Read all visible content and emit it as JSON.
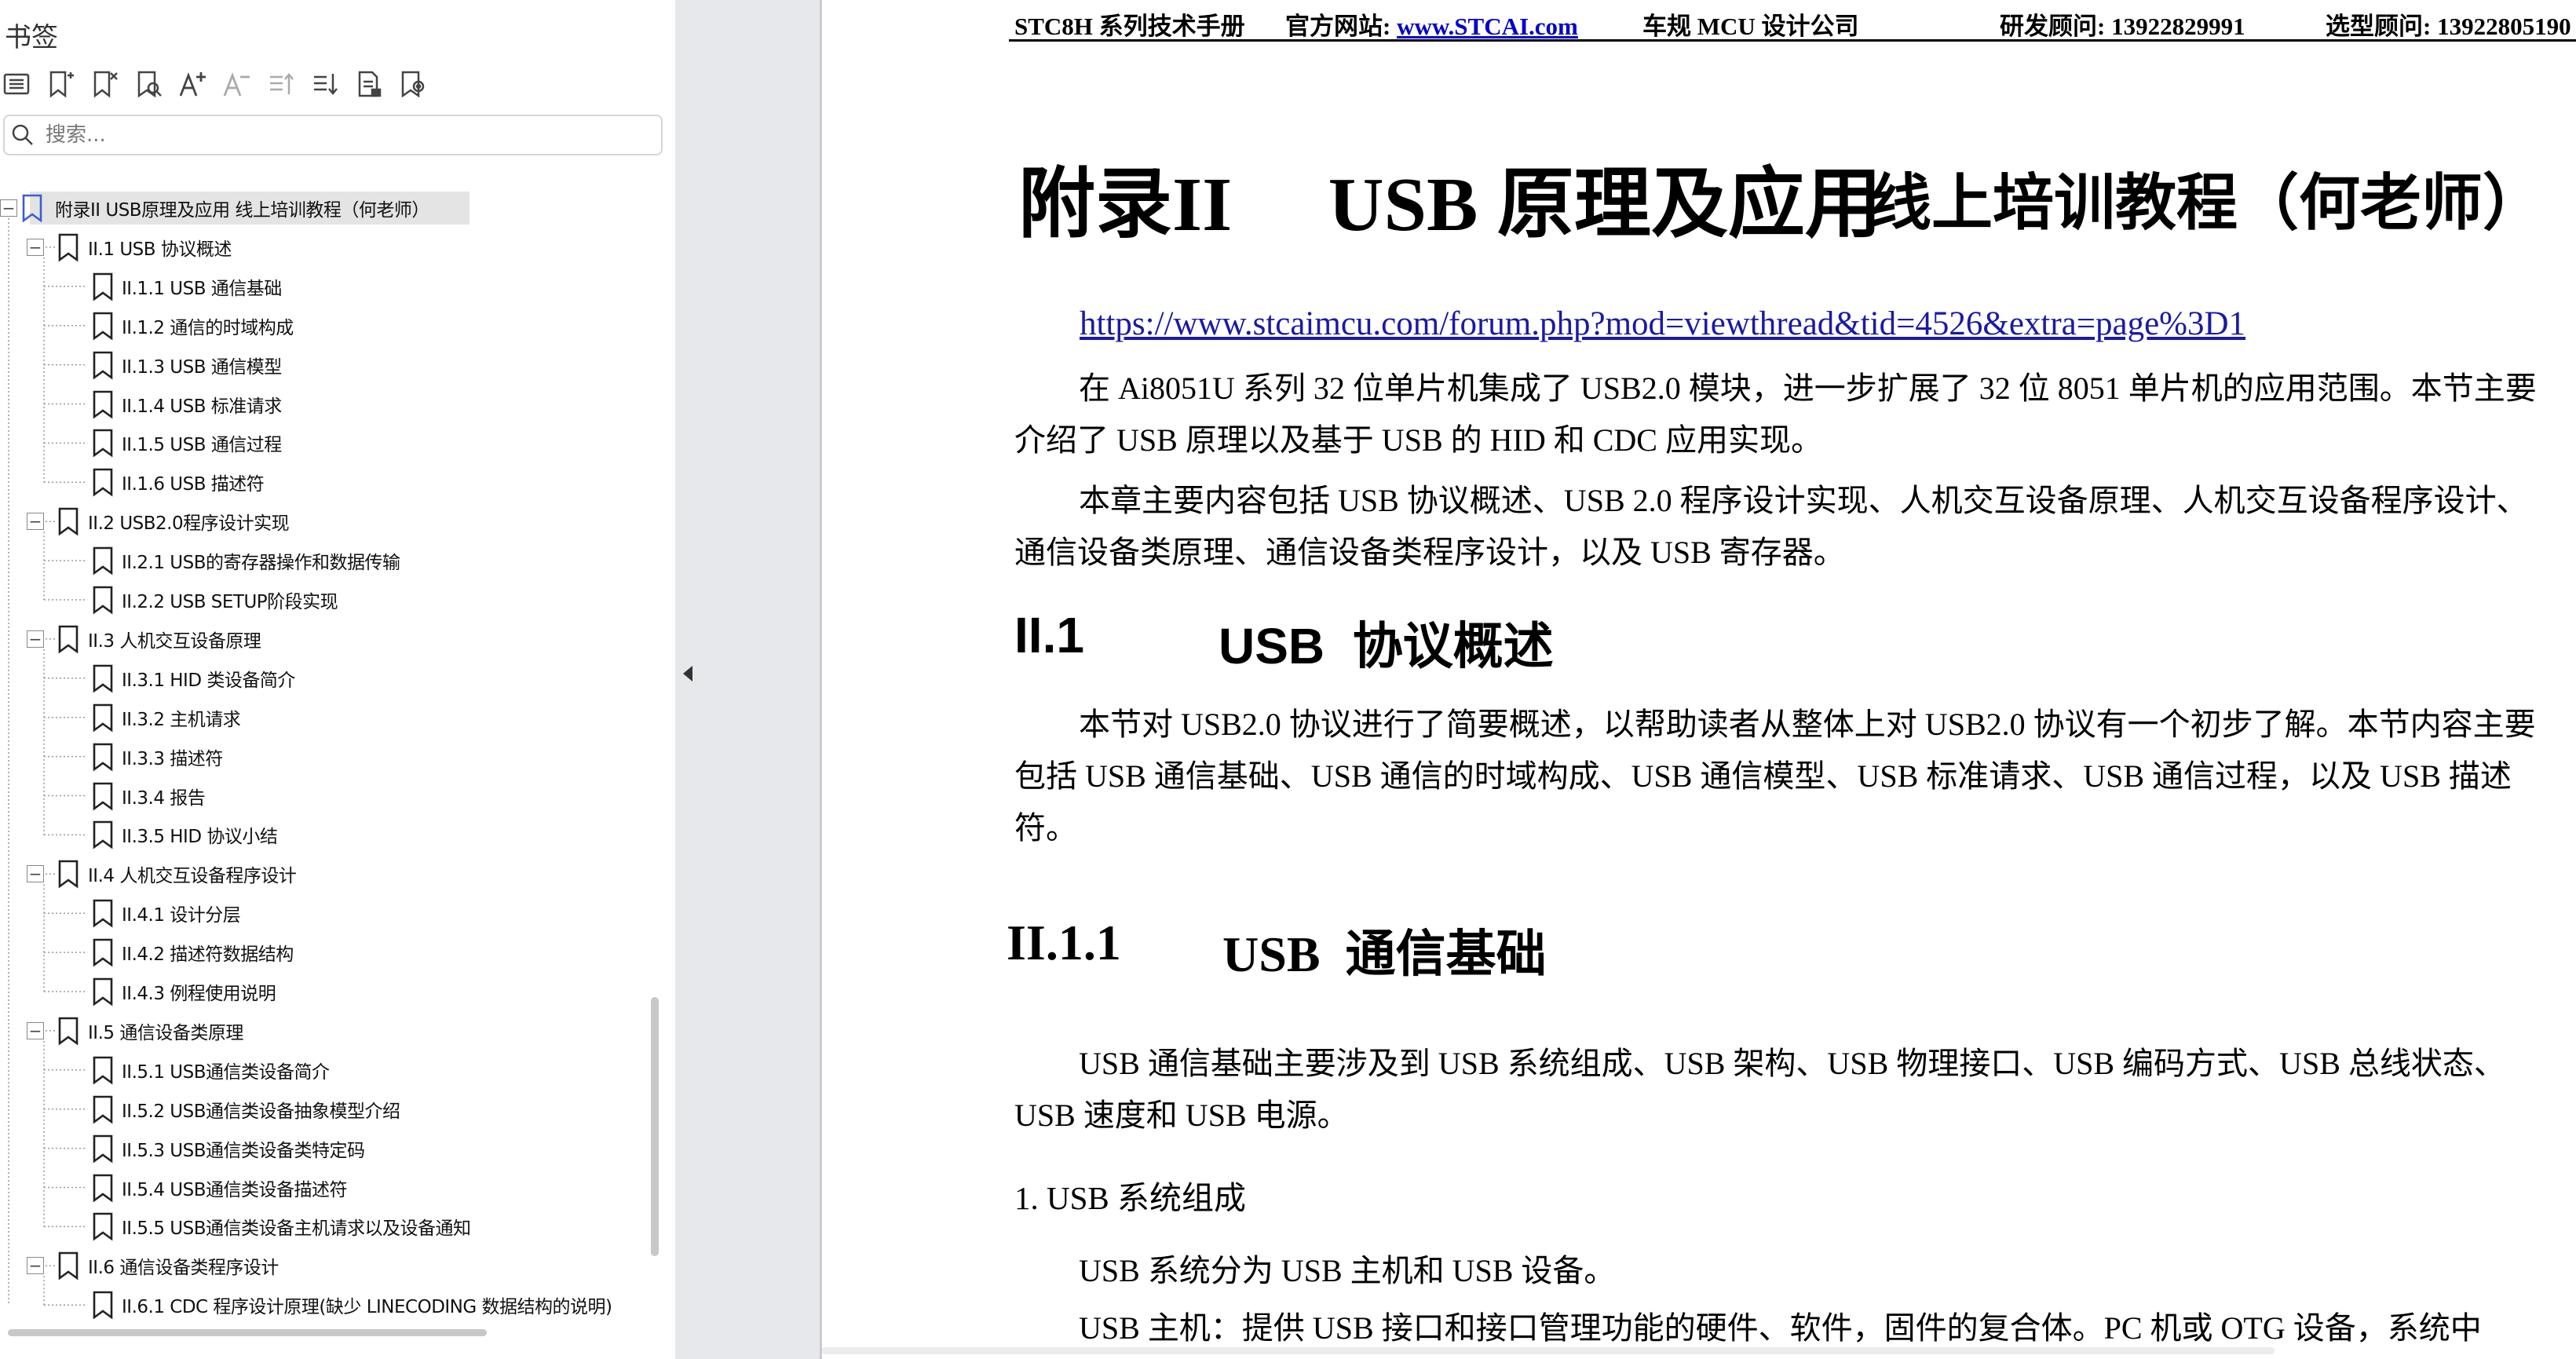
{
  "sidebar": {
    "title": "书签",
    "toolbar_icons": [
      "expand-list-icon",
      "add-bookmark-icon",
      "delete-bookmark-icon",
      "find-bookmark-icon",
      "font-increase-icon",
      "font-decrease-icon",
      "promote-bookmark-icon",
      "demote-bookmark-icon",
      "bookmark-properties-icon",
      "bookmark-settings-icon"
    ],
    "search_placeholder": "搜索...",
    "tree": [
      {
        "level": 0,
        "label": "附录II  USB原理及应用 线上培训教程（何老师）",
        "expanded": true,
        "selected": true
      },
      {
        "level": 1,
        "label": "II.1 USB 协议概述",
        "expanded": true
      },
      {
        "level": 2,
        "label": "II.1.1 USB 通信基础"
      },
      {
        "level": 2,
        "label": "II.1.2 通信的时域构成"
      },
      {
        "level": 2,
        "label": "II.1.3 USB 通信模型"
      },
      {
        "level": 2,
        "label": "II.1.4 USB 标准请求"
      },
      {
        "level": 2,
        "label": "II.1.5 USB 通信过程"
      },
      {
        "level": 2,
        "label": "II.1.6 USB 描述符"
      },
      {
        "level": 1,
        "label": "II.2  USB2.0程序设计实现",
        "expanded": true
      },
      {
        "level": 2,
        "label": "II.2.1 USB的寄存器操作和数据传输"
      },
      {
        "level": 2,
        "label": "II.2.2 USB SETUP阶段实现"
      },
      {
        "level": 1,
        "label": "II.3  人机交互设备原理",
        "expanded": true
      },
      {
        "level": 2,
        "label": "II.3.1 HID 类设备简介"
      },
      {
        "level": 2,
        "label": "II.3.2 主机请求"
      },
      {
        "level": 2,
        "label": "II.3.3 描述符"
      },
      {
        "level": 2,
        "label": "II.3.4 报告"
      },
      {
        "level": 2,
        "label": "II.3.5 HID 协议小结"
      },
      {
        "level": 1,
        "label": "II.4  人机交互设备程序设计",
        "expanded": true
      },
      {
        "level": 2,
        "label": "II.4.1 设计分层"
      },
      {
        "level": 2,
        "label": "II.4.2 描述符数据结构"
      },
      {
        "level": 2,
        "label": "II.4.3 例程使用说明"
      },
      {
        "level": 1,
        "label": "II.5  通信设备类原理",
        "expanded": true
      },
      {
        "level": 2,
        "label": "II.5.1 USB通信类设备简介"
      },
      {
        "level": 2,
        "label": "II.5.2 USB通信类设备抽象模型介绍"
      },
      {
        "level": 2,
        "label": "II.5.3 USB通信类设备类特定码"
      },
      {
        "level": 2,
        "label": "II.5.4 USB通信类设备描述符"
      },
      {
        "level": 2,
        "label": "II.5.5 USB通信类设备主机请求以及设备通知"
      },
      {
        "level": 1,
        "label": "II.6  通信设备类程序设计",
        "expanded": true
      },
      {
        "level": 2,
        "label": "II.6.1 CDC 程序设计原理(缺少 LINECODING 数据结构的说明)"
      }
    ]
  },
  "document": {
    "header": {
      "manual": "STC8H 系列技术手册",
      "site_label": "官方网站: ",
      "site_link": "www.STCAI.com",
      "company": "车规 MCU 设计公司",
      "rd_contact": "研发顾问: 13922829991",
      "sel_contact": "选型顾问: 13922805190"
    },
    "appendix_title": "附录II     USB 原理及应用",
    "appendix_subtitle": "线上培训教程（何老师）",
    "forum_link": "https://www.stcaimcu.com/forum.php?mod=viewthread&tid=4526&extra=page%3D1",
    "intro_p1": "在 Ai8051U 系列 32 位单片机集成了 USB2.0 模块，进一步扩展了 32 位 8051 单片机的应用范围。本节主要介绍了 USB 原理以及基于 USB 的 HID 和 CDC 应用实现。",
    "intro_p2": "本章主要内容包括 USB 协议概述、USB 2.0 程序设计实现、人机交互设备原理、人机交互设备程序设计、通信设备类原理、通信设备类程序设计，以及 USB 寄存器。",
    "sec1_num": "II.1",
    "sec1_title": "USB  协议概述",
    "sec1_p": "本节对 USB2.0 协议进行了简要概述，以帮助读者从整体上对 USB2.0 协议有一个初步了解。本节内容主要包括 USB 通信基础、USB 通信的时域构成、USB 通信模型、USB 标准请求、USB 通信过程，以及 USB 描述符。",
    "sec11_num": "II.1.1",
    "sec11_title": "USB  通信基础",
    "sec11_p": "USB 通信基础主要涉及到 USB 系统组成、USB 架构、USB 物理接口、USB 编码方式、USB 总线状态、USB 速度和 USB 电源。",
    "item1_head": "1. USB 系统组成",
    "item1_p1": "USB 系统分为 USB 主机和 USB 设备。",
    "item1_p2": "USB 主机：提供 USB 接口和接口管理功能的硬件、软件，固件的复合体。PC 机或 OTG 设备，系统中"
  }
}
